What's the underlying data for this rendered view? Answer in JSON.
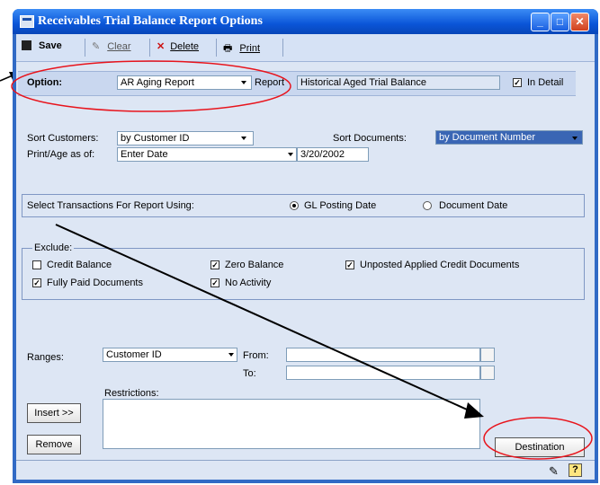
{
  "window": {
    "title": "Receivables Trial Balance Report Options"
  },
  "toolbar": {
    "save": "Save",
    "clear": "Clear",
    "delete": "Delete",
    "print": "Print"
  },
  "option": {
    "label": "Option:",
    "value": "AR Aging Report",
    "report_label": "Report",
    "report_value": "Historical Aged Trial Balance",
    "in_detail": "In Detail"
  },
  "sort": {
    "customers_label": "Sort Customers:",
    "customers_value": "by Customer ID",
    "documents_label": "Sort Documents:",
    "documents_value": "by Document Number"
  },
  "print_age": {
    "label": "Print/Age as of:",
    "value": "Enter Date",
    "date": "3/20/2002"
  },
  "transactions": {
    "label": "Select Transactions For Report Using:",
    "gl_posting": "GL Posting Date",
    "document_date": "Document Date"
  },
  "exclude": {
    "label": "Exclude:",
    "items": [
      {
        "label": "Credit Balance",
        "checked": false
      },
      {
        "label": "Zero Balance",
        "checked": true
      },
      {
        "label": "Unposted Applied Credit Documents",
        "checked": true
      },
      {
        "label": "Fully Paid Documents",
        "checked": true
      },
      {
        "label": "No Activity",
        "checked": true
      }
    ]
  },
  "ranges": {
    "label": "Ranges:",
    "value": "Customer ID",
    "from": "From:",
    "to": "To:",
    "restrictions": "Restrictions:"
  },
  "buttons": {
    "insert": "Insert >>",
    "remove": "Remove",
    "destination": "Destination"
  },
  "annotations": {
    "circle_color": "#e8141c",
    "arrow_color": "#000000"
  }
}
